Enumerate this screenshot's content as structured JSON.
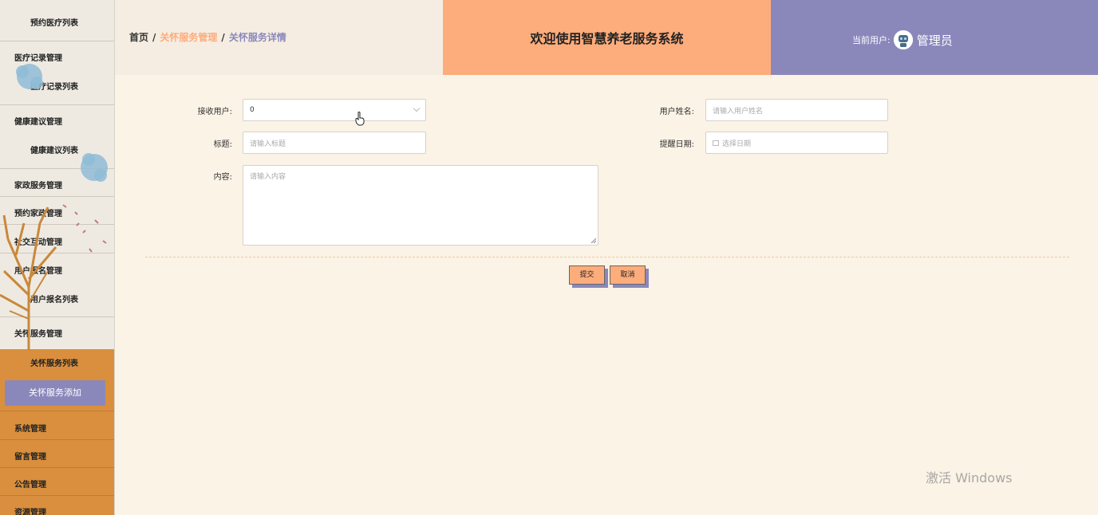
{
  "sidebar": {
    "items": [
      {
        "label": "预约医疗列表",
        "type": "sub"
      },
      {
        "label": "医疗记录管理",
        "type": "group"
      },
      {
        "label": "医疗记录列表",
        "type": "sub"
      },
      {
        "label": "健康建议管理",
        "type": "group"
      },
      {
        "label": "健康建议列表",
        "type": "sub"
      },
      {
        "label": "家政服务管理",
        "type": "group"
      },
      {
        "label": "预约家政管理",
        "type": "group"
      },
      {
        "label": "社交互动管理",
        "type": "group"
      },
      {
        "label": "用户报名管理",
        "type": "group"
      },
      {
        "label": "用户报名列表",
        "type": "sub"
      },
      {
        "label": "关怀服务管理",
        "type": "group"
      },
      {
        "label": "关怀服务列表",
        "type": "sub"
      },
      {
        "label": "关怀服务添加",
        "type": "active"
      },
      {
        "label": "系统管理",
        "type": "group"
      },
      {
        "label": "留言管理",
        "type": "group"
      },
      {
        "label": "公告管理",
        "type": "group"
      },
      {
        "label": "资源管理",
        "type": "group"
      }
    ]
  },
  "header": {
    "breadcrumb": [
      "首页",
      "关怀服务管理",
      "关怀服务详情"
    ],
    "breadcrumb_sep": "/",
    "title": "欢迎使用智慧养老服务系统",
    "user_label": "当前用户:",
    "user_name": "管理员"
  },
  "form": {
    "receiver_label": "接收用户:",
    "receiver_value": "0",
    "username_label": "用户姓名:",
    "username_placeholder": "请输入用户姓名",
    "title_label": "标题:",
    "title_placeholder": "请输入标题",
    "remind_date_label": "提醒日期:",
    "remind_date_placeholder": "选择日期",
    "content_label": "内容:",
    "content_placeholder": "请输入内容",
    "submit_label": "提交",
    "cancel_label": "取消"
  },
  "watermark": "激活 Windows",
  "colors": {
    "peach": "#fdac7b",
    "lavender": "#8a88bb",
    "orange": "#d98f3d",
    "background": "#faf3e6"
  }
}
